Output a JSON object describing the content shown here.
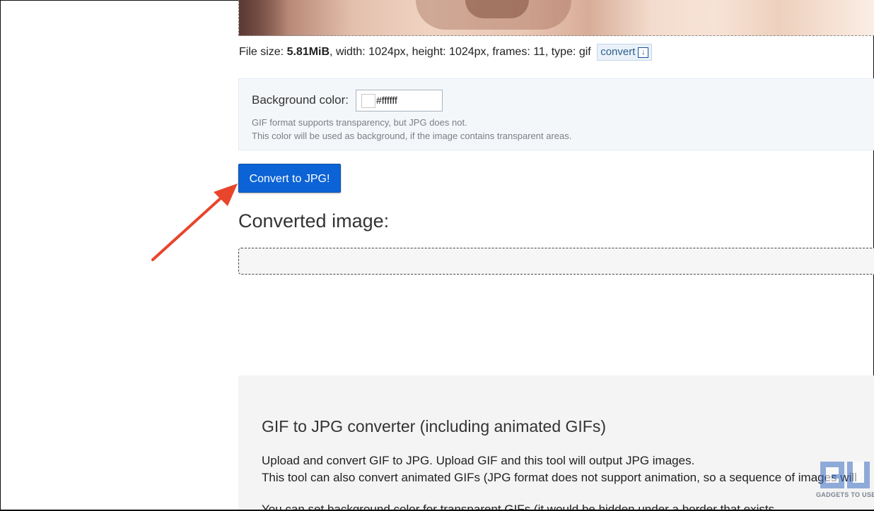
{
  "file_info": {
    "size_label": "File size: ",
    "size_value": "5.81MiB",
    "details": ", width: 1024px, height: 1024px, frames: 11, type: gif",
    "convert_label": "convert"
  },
  "options": {
    "bg_label": "Background color:",
    "color_value": "#ffffff",
    "hint_line1": "GIF format supports transparency, but JPG does not.",
    "hint_line2": "This color will be used as background, if the image contains transparent areas."
  },
  "actions": {
    "convert_button": "Convert to JPG!"
  },
  "result": {
    "heading": "Converted image:"
  },
  "info": {
    "heading": "GIF to JPG converter (including animated GIFs)",
    "line1": "Upload and convert GIF to JPG. Upload GIF and this tool will output JPG images.",
    "line2": "This tool can also convert animated GIFs (JPG format does not support animation, so a sequence of images will",
    "line3": "You can set background color for transparent GIFs (it would be hidden under a border that exists"
  },
  "annotation": {
    "arrow_color": "#e8452c"
  },
  "watermark": {
    "text": "GADGETS TO USE"
  },
  "colors": {
    "primary_button": "#0c63d6",
    "options_bg": "#f4f7fa",
    "info_bg": "#f4f4f4"
  }
}
